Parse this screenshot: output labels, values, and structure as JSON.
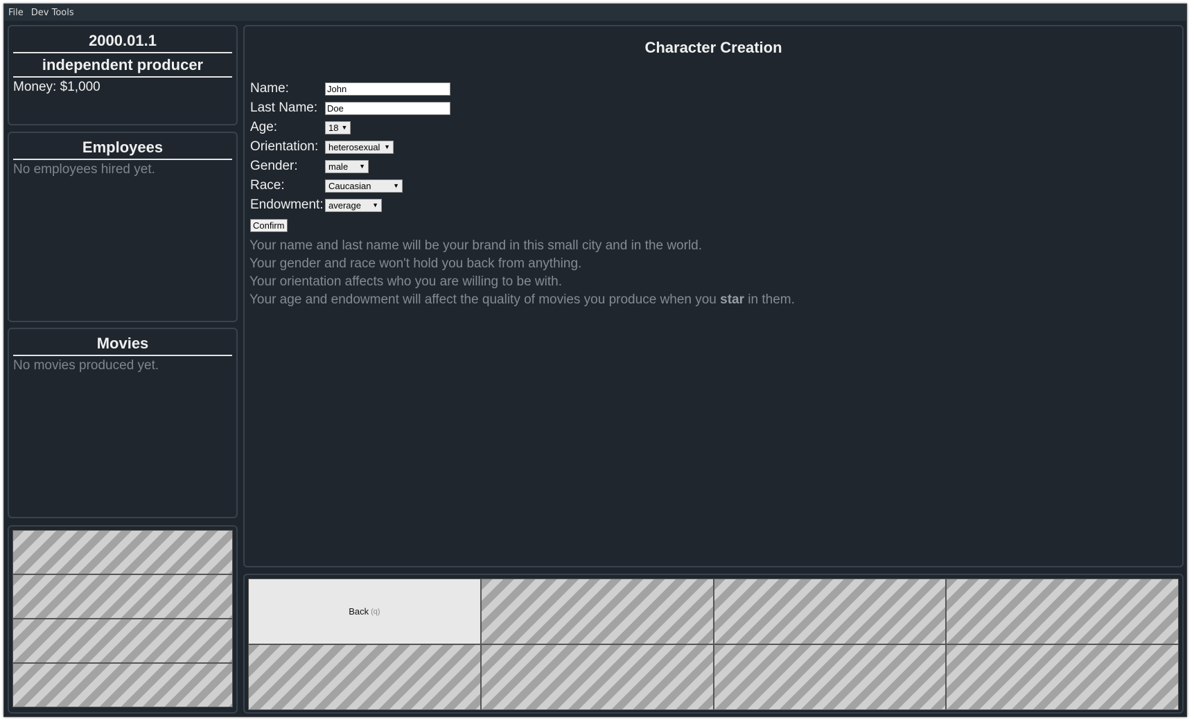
{
  "menubar": {
    "items": [
      "File",
      "Dev Tools"
    ]
  },
  "status": {
    "date": "2000.01.1",
    "role": "independent producer",
    "money": "Money: $1,000"
  },
  "employees": {
    "title": "Employees",
    "empty": "No employees hired yet."
  },
  "movies": {
    "title": "Movies",
    "empty": "No movies produced yet."
  },
  "main": {
    "title": "Character Creation",
    "form": {
      "name_label": "Name:",
      "name_value": "John",
      "lastname_label": "Last Name:",
      "lastname_value": "Doe",
      "age_label": "Age:",
      "age_value": "18",
      "orientation_label": "Orientation:",
      "orientation_value": "heterosexual",
      "gender_label": "Gender:",
      "gender_value": "male",
      "race_label": "Race:",
      "race_value": "Caucasian",
      "endowment_label": "Endowment:",
      "endowment_value": "average",
      "confirm_label": "Confirm"
    },
    "info": {
      "line1": "Your name and last name will be your brand in this small city and in the world.",
      "line2": "Your gender and race won't hold you back from anything.",
      "line3": "Your orientation affects who you are willing to be with.",
      "line4_pre": "Your age and endowment will affect the quality of movies you produce when you ",
      "line4_bold": "star",
      "line4_post": " in them."
    }
  },
  "actions": {
    "back_label": "Back",
    "back_key": "(q)"
  },
  "icons": {
    "select_arrow": "triangle-down-icon"
  },
  "colors": {
    "background": "#1e252d",
    "panel_border": "#38434d",
    "muted_text": "#858b91"
  }
}
